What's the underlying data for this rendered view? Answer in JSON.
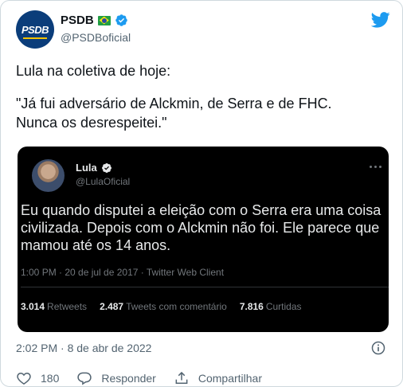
{
  "author": {
    "display_name": "PSDB",
    "handle": "@PSDBoficial",
    "avatar_text": "PSDB",
    "flag_icon": "brazil-flag-icon",
    "verified_icon": "verified-badge-icon"
  },
  "tweet": {
    "line1": "Lula na coletiva de hoje:",
    "line2": "\"Já fui adversário de Alckmin, de Serra e de FHC.\nNunca os desrespeitei.\"",
    "timestamp": "2:02 PM · 8 de abr de 2022"
  },
  "quoted_tweet": {
    "display_name": "Lula",
    "handle": "@LulaOficial",
    "text": "Eu quando disputei a eleição com o Serra era uma coisa civilizada. Depois com o Alckmin não foi. Ele parece que mamou até os 14 anos.",
    "meta": "1:00 PM · 20 de jul de 2017 · Twitter Web Client",
    "stats": [
      {
        "count": "3.014",
        "label": "Retweets"
      },
      {
        "count": "2.487",
        "label": "Tweets com comentário"
      },
      {
        "count": "7.816",
        "label": "Curtidas"
      }
    ]
  },
  "actions": {
    "like_count": "180",
    "reply_label": "Responder",
    "share_label": "Compartilhar"
  },
  "colors": {
    "twitter_blue": "#1d9bf0",
    "text_primary": "#0f1419",
    "text_secondary": "#536471",
    "quote_bg": "#000000"
  }
}
